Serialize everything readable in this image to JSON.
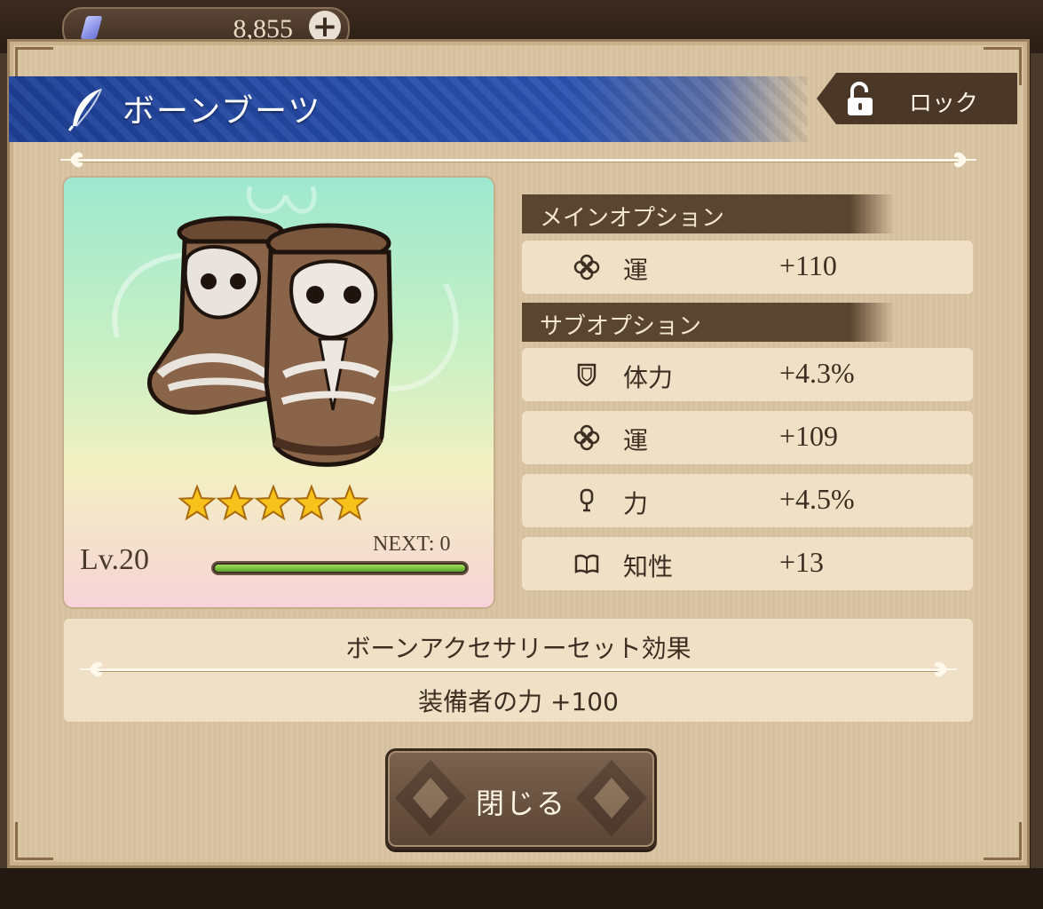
{
  "currency": {
    "amount": "8,855"
  },
  "item": {
    "name": "ボーンブーツ",
    "level": "Lv.20",
    "next": "NEXT: 0",
    "rarity_stars": 5,
    "exp_progress": 1.0
  },
  "lock": {
    "label": "ロック"
  },
  "main_option": {
    "header": "メインオプション",
    "stats": [
      {
        "icon": "clover-icon",
        "name": "運",
        "value": "+110"
      }
    ]
  },
  "sub_option": {
    "header": "サブオプション",
    "stats": [
      {
        "icon": "shield-icon",
        "name": "体力",
        "value": "+4.3%"
      },
      {
        "icon": "clover-icon",
        "name": "運",
        "value": "+109"
      },
      {
        "icon": "fist-icon",
        "name": "力",
        "value": "+4.5%"
      },
      {
        "icon": "book-icon",
        "name": "知性",
        "value": "+13"
      }
    ]
  },
  "set_bonus": {
    "title": "ボーンアクセサリーセット効果",
    "effect": "装備者の力 +100"
  },
  "close_button": {
    "label": "閉じる"
  },
  "colors": {
    "title_bar": "#2a52b0",
    "header_brown": "#5a4530",
    "panel": "#d9c4a3"
  }
}
